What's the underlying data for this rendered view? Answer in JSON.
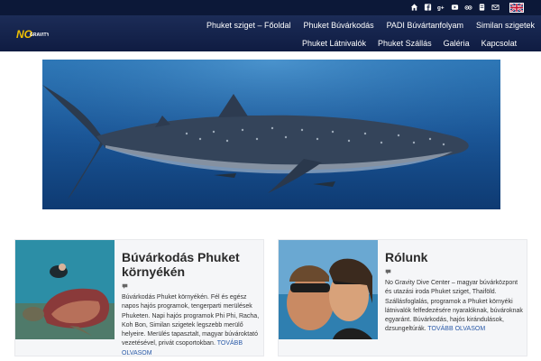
{
  "topbar": {
    "icons": [
      "home-icon",
      "facebook-icon",
      "google-plus-icon",
      "youtube-icon",
      "tripadvisor-icon",
      "blog-icon",
      "email-icon"
    ],
    "language_flag": "uk-flag-icon"
  },
  "header": {
    "logo_text": "NO GRAVITY",
    "nav_row1": [
      "Phuket sziget – Főoldal",
      "Phuket Búvárkodás",
      "PADI Búvártanfolyam",
      "Similan szigetek"
    ],
    "nav_row2": [
      "Phuket Látnivalók",
      "Phuket Szállás",
      "Galéria",
      "Kapcsolat"
    ]
  },
  "hero": {
    "alt_icon": "whale-shark-image"
  },
  "cards": [
    {
      "title": "Búvárkodás Phuket környékén",
      "comment_icon": "comment-icon",
      "text": "Búvárkodás Phuket környékén. Fél és egész napos hajós programok, tengerparti merülések Phuketen. Napi hajós programok Phi Phi, Racha, Koh Bon, Similan szigetek legszebb merülő helyeire. Merülés tapasztalt, magyar búvároktató vezetésével, privát csoportokban.",
      "more": "TOVÁBB OLVASOM"
    },
    {
      "title": "Rólunk",
      "comment_icon": "comment-icon",
      "text": "No Gravity Dive Center – magyar búvárközpont és utazási iroda Phuket sziget, Thaiföld. Szállásfoglalás, programok a Phuket környéki látnivalók felfedezésére nyaralóknak, búvároknak egyaránt. Búvárkodás, hajós kirándulások, dzsungeltúrák.",
      "more": "TOVÁBB OLVASOM"
    }
  ],
  "colors": {
    "topbar": "#0c1838",
    "header": "#1c2c57",
    "accent": "#2a5aa8"
  }
}
